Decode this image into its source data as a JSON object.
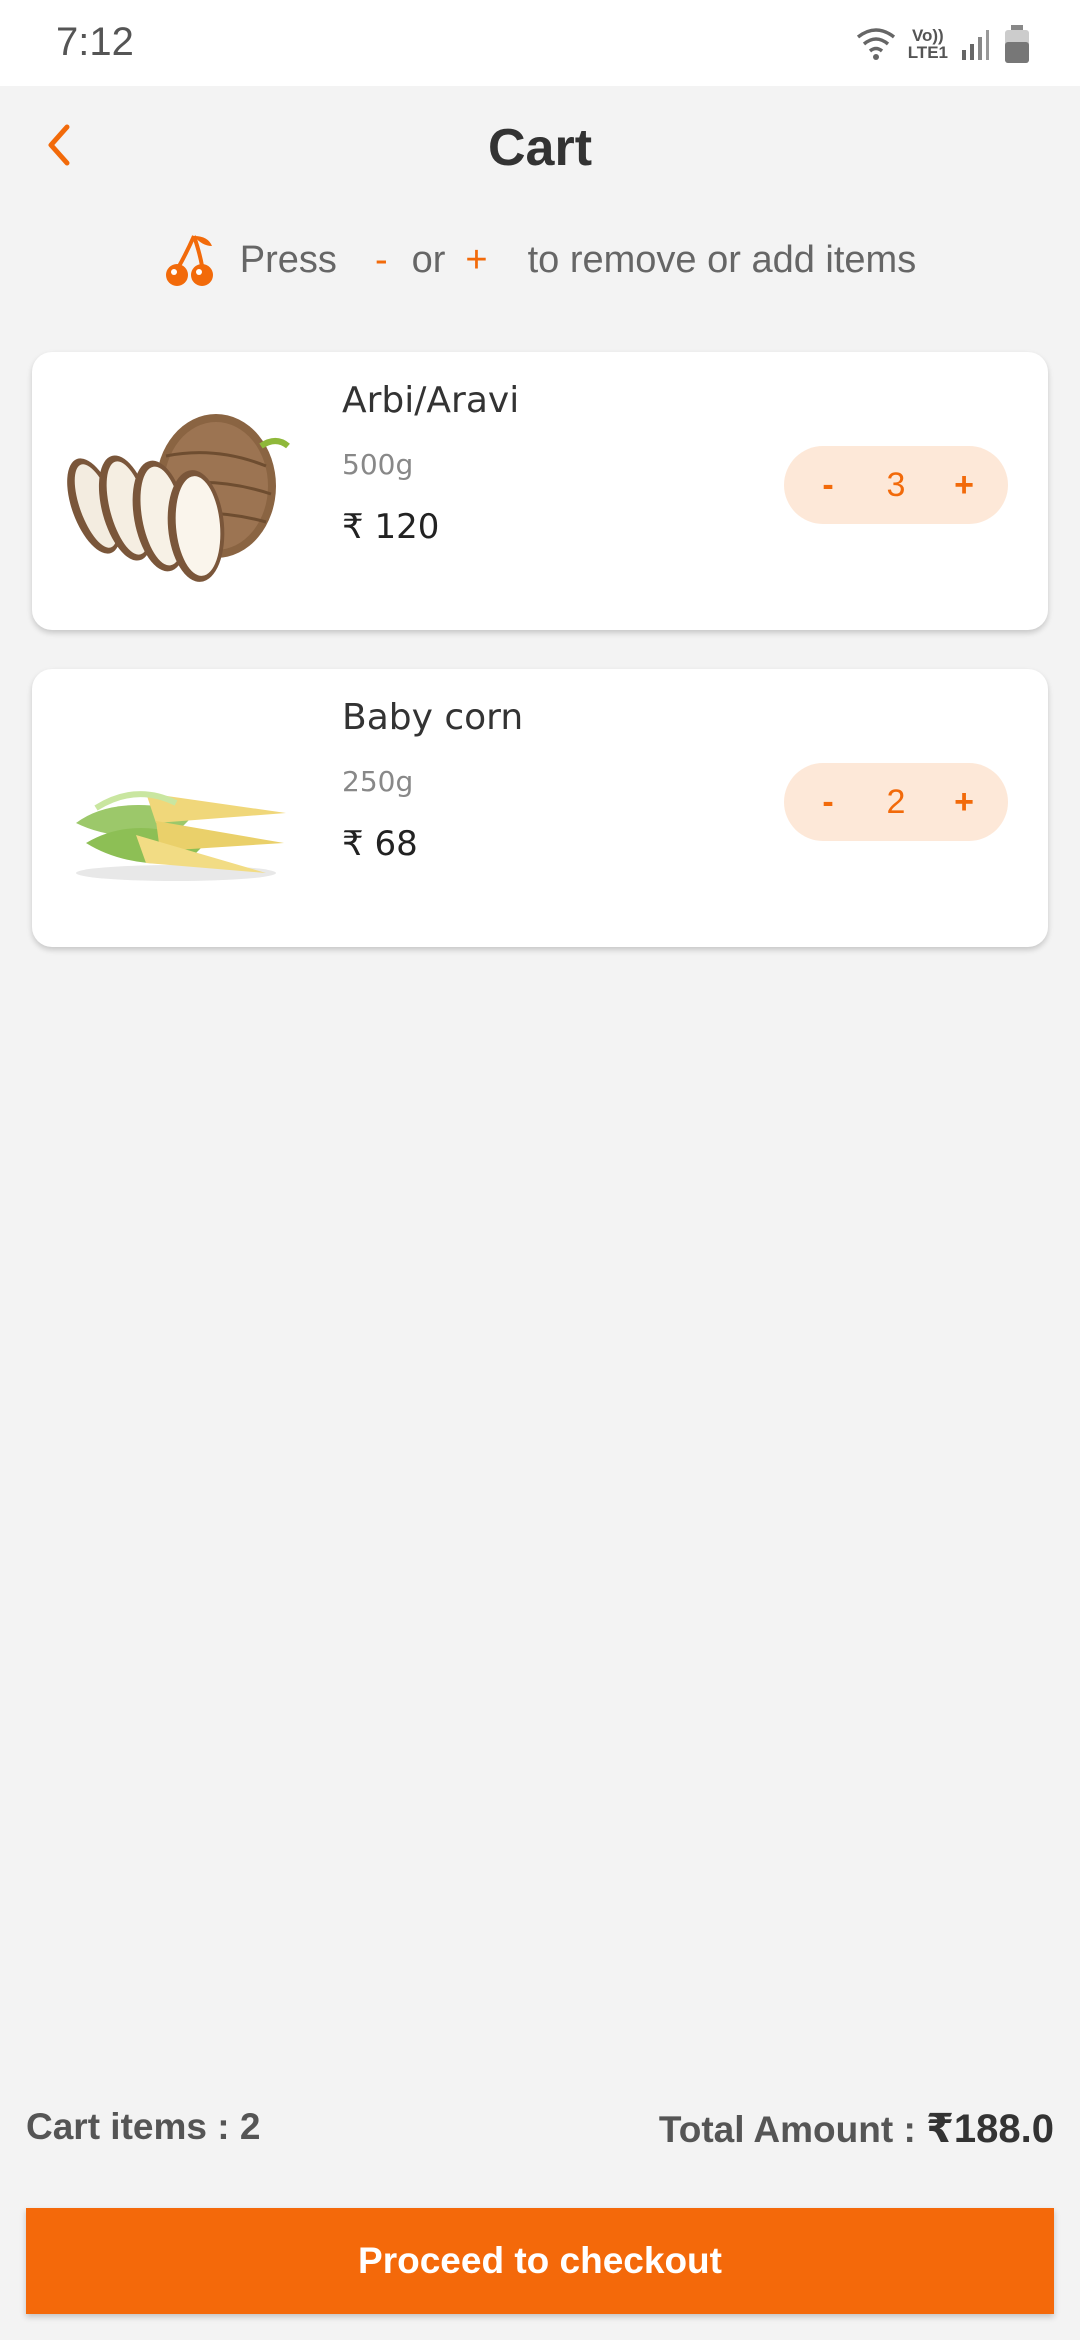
{
  "status_bar": {
    "time": "7:12",
    "network_label_top": "Vo))",
    "network_label_bottom": "LTE1",
    "icons": [
      "wifi-icon",
      "signal-icon",
      "battery-icon"
    ]
  },
  "header": {
    "title": "Cart",
    "back_icon": "chevron-left-icon"
  },
  "hint": {
    "icon": "cherry-icon",
    "press": "Press",
    "minus": "-",
    "or": "or",
    "plus": "+",
    "suffix": "to remove or add items"
  },
  "cart_items": [
    {
      "name": "Arbi/Aravi",
      "weight": "500g",
      "price": "₹ 120",
      "quantity": "3",
      "minus_label": "-",
      "plus_label": "+",
      "image": "taro-root-image"
    },
    {
      "name": "Baby corn",
      "weight": "250g",
      "price": "₹ 68",
      "quantity": "2",
      "minus_label": "-",
      "plus_label": "+",
      "image": "baby-corn-image"
    }
  ],
  "footer": {
    "cart_items_label": "Cart items : 2",
    "total_label": "Total Amount : ",
    "total_value": "₹188.0",
    "checkout_label": "Proceed to checkout"
  },
  "colors": {
    "accent": "#f4690a",
    "stepper_bg": "#fde8d8",
    "background": "#f3f3f3"
  }
}
